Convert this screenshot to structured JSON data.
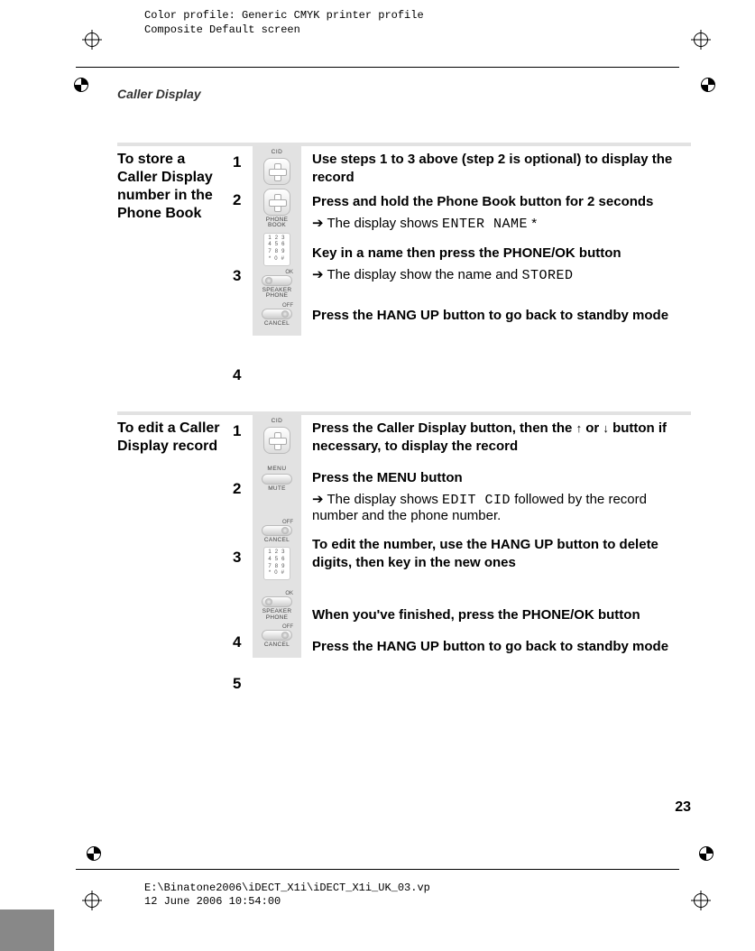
{
  "prepress": {
    "line1": "Color profile: Generic CMYK printer profile",
    "line2": "Composite  Default screen",
    "footer_line1": "E:\\Binatone2006\\iDECT_X1i\\iDECT_X1i_UK_03.vp",
    "footer_line2": "12 June 2006 10:54:00"
  },
  "header": {
    "section": "Caller Display"
  },
  "page_number": "23",
  "icon_labels": {
    "cid": "CID",
    "phone_book": "PHONE BOOK",
    "ok": "OK",
    "speaker_phone": "SPEAKER PHONE",
    "off": "OFF",
    "cancel": "CANCEL",
    "menu": "MENU",
    "mute": "MUTE",
    "keypad_r1": "1 2 3",
    "keypad_r2": "4 5 6",
    "keypad_r3": "7 8 9",
    "keypad_r4": "* 0 #"
  },
  "block1": {
    "title": "To store a Caller Display number in the Phone Book",
    "steps": {
      "n1": "1",
      "n2": "2",
      "n3": "3",
      "n4": "4"
    },
    "s1": "Use steps 1 to 3 above (step 2 is optional) to display the record",
    "s2a": "Press and hold the ",
    "s2b": "Phone Book",
    "s2c": " button for 2 seconds",
    "s2_arrow": "➔  The display shows ",
    "s2_lcd": "ENTER NAME",
    "s2_suffix": " *",
    "s3a": "Key in a name then press the ",
    "s3b": "PHONE/OK",
    "s3c": " button",
    "s3_arrow": "➔  The display show the name and  ",
    "s3_lcd": "STORED",
    "s4a": "Press the ",
    "s4b": "HANG UP",
    "s4c": " button to go back to standby mode"
  },
  "block2": {
    "title": "To edit a Caller Display record",
    "steps": {
      "n1": "1",
      "n2": "2",
      "n3": "3",
      "n4": "4",
      "n5": "5"
    },
    "s1a": "Press the Caller Display button, then the ",
    "s1b": " or ",
    "s1c": " button if necessary, to display the record",
    "s2a": "Press the ",
    "s2b": "MENU",
    "s2c": " button",
    "s2_arrow": "➔  The display shows  ",
    "s2_lcd": "EDIT CID",
    "s2_tail": " followed by the record number and the phone number.",
    "s3a": "To edit the number, use the ",
    "s3b": "HANG UP",
    "s3c": " button to delete digits, then key in the new ones",
    "s4a": "When you've finished, press the ",
    "s4b": "PHONE/OK",
    "s4c": " button",
    "s5a": "Press the ",
    "s5b": "HANG UP",
    "s5c": " button to go back to standby mode"
  }
}
